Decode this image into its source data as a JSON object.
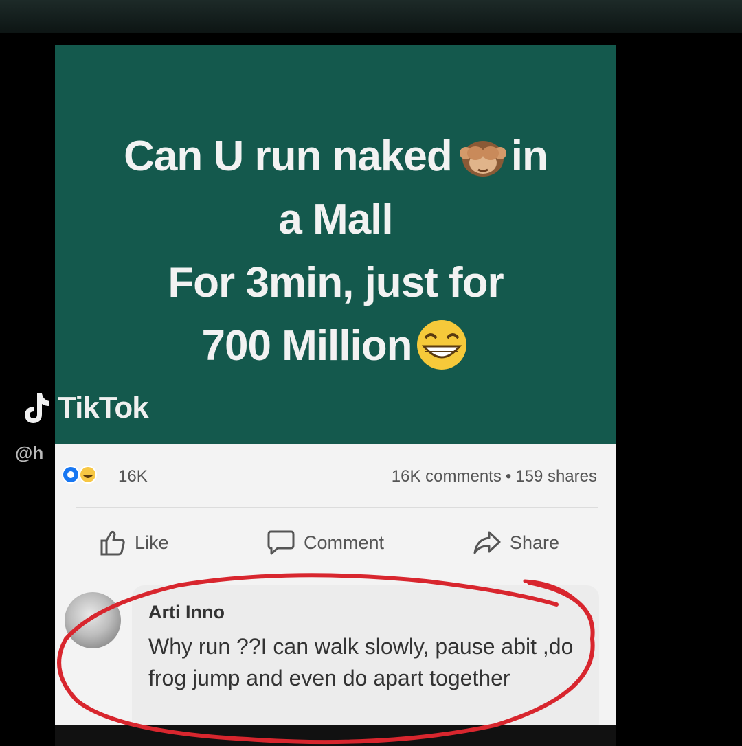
{
  "hero": {
    "line1": "Can U run naked",
    "line1_end": "in",
    "line2": "a Mall",
    "line3": "For 3min, just for",
    "line4": "700 Million"
  },
  "stats": {
    "reactions_count": "16K",
    "comments": "16K comments",
    "separator": "•",
    "shares": "159 shares"
  },
  "actions": {
    "like": "Like",
    "comment": "Comment",
    "share": "Share"
  },
  "comment": {
    "author": "Arti Inno",
    "text": "Why run ??I can  walk slowly, pause abit ,do frog jump and even do apart together"
  },
  "watermark": {
    "brand": "TikTok",
    "handle": "@h"
  },
  "colors": {
    "hero_bg": "#14594d",
    "annotation_red": "#d8262e"
  },
  "icons": [
    "see-no-evil-monkey-icon",
    "grinning-face-icon",
    "like-reaction-icon",
    "haha-reaction-icon",
    "thumbs-up-icon",
    "comment-bubble-icon",
    "share-arrow-icon",
    "tiktok-logo-icon"
  ]
}
